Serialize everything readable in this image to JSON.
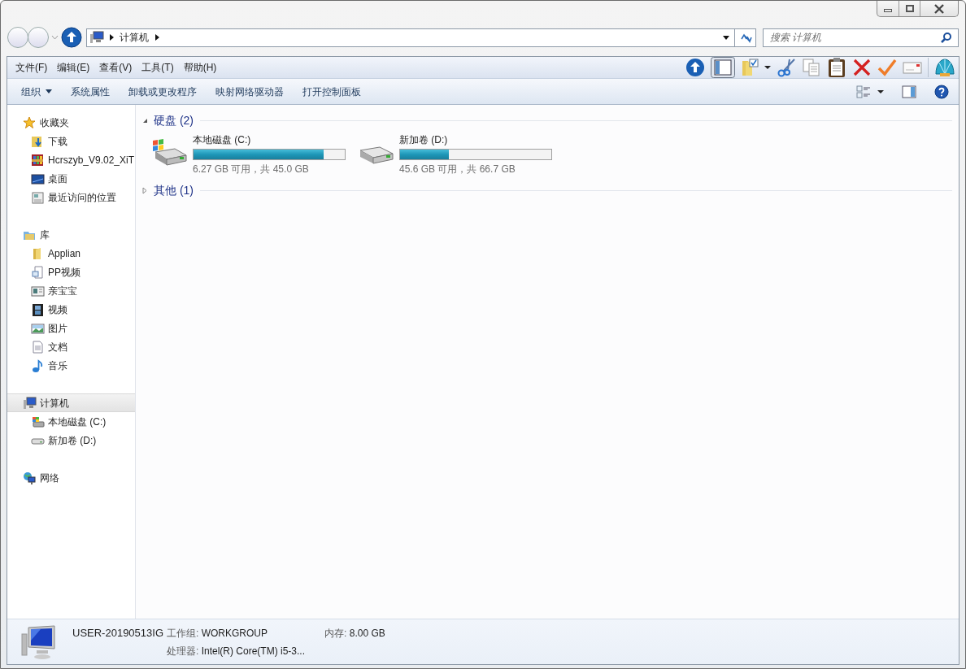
{
  "address": {
    "crumbs": [
      "计算机"
    ],
    "search_placeholder": "搜索 计算机"
  },
  "menu": [
    "文件(F)",
    "编辑(E)",
    "查看(V)",
    "工具(T)",
    "帮助(H)"
  ],
  "commands": [
    {
      "label": "组织",
      "kind": "dropdown"
    },
    {
      "label": "系统属性",
      "kind": "plain"
    },
    {
      "label": "卸载或更改程序",
      "kind": "plain"
    },
    {
      "label": "映射网络驱动器",
      "kind": "plain"
    },
    {
      "label": "打开控制面板",
      "kind": "plain"
    }
  ],
  "sidebar": [
    {
      "label": "收藏夹",
      "kind": "star",
      "selected": false,
      "children": [
        {
          "label": "下载",
          "kind": "download",
          "selected": false
        },
        {
          "label": "Hcrszyb_V9.02_XiT",
          "kind": "archive",
          "selected": false
        },
        {
          "label": "桌面",
          "kind": "desktop",
          "selected": false
        },
        {
          "label": "最近访问的位置",
          "kind": "recent",
          "selected": false
        }
      ]
    },
    {
      "label": "库",
      "kind": "library",
      "selected": false,
      "children": [
        {
          "label": "Applian",
          "kind": "folder",
          "selected": false
        },
        {
          "label": "PP视频",
          "kind": "appdoc",
          "selected": false
        },
        {
          "label": "亲宝宝",
          "kind": "window",
          "selected": false
        },
        {
          "label": "视频",
          "kind": "film",
          "selected": false
        },
        {
          "label": "图片",
          "kind": "image",
          "selected": false
        },
        {
          "label": "文档",
          "kind": "document",
          "selected": false
        },
        {
          "label": "音乐",
          "kind": "music",
          "selected": false
        }
      ]
    },
    {
      "label": "计算机",
      "kind": "computer",
      "selected": true,
      "children": [
        {
          "label": "本地磁盘 (C:)",
          "kind": "sysdrive",
          "selected": false
        },
        {
          "label": "新加卷 (D:)",
          "kind": "drive",
          "selected": false
        }
      ]
    },
    {
      "label": "网络",
      "kind": "network",
      "selected": false
    }
  ],
  "groups": [
    {
      "title": "硬盘 (2)",
      "expanded": true,
      "drives": [
        {
          "name": "本地磁盘 (C:)",
          "kind": "sysdrive",
          "level": 0.86,
          "space": "6.27 GB 可用，共 45.0 GB"
        },
        {
          "name": "新加卷 (D:)",
          "kind": "drive",
          "level": 0.32,
          "space": "45.6 GB 可用，共 66.7 GB"
        }
      ]
    },
    {
      "title": "其他 (1)",
      "expanded": false
    }
  ],
  "status": {
    "computer_name": "USER-20190513IG",
    "fields": [
      {
        "label": "工作组:",
        "value": "WORKGROUP"
      },
      {
        "label": "内存:",
        "value": "8.00 GB"
      },
      {
        "label": "处理器:",
        "value": "Intel(R) Core(TM) i5-3..."
      }
    ]
  }
}
